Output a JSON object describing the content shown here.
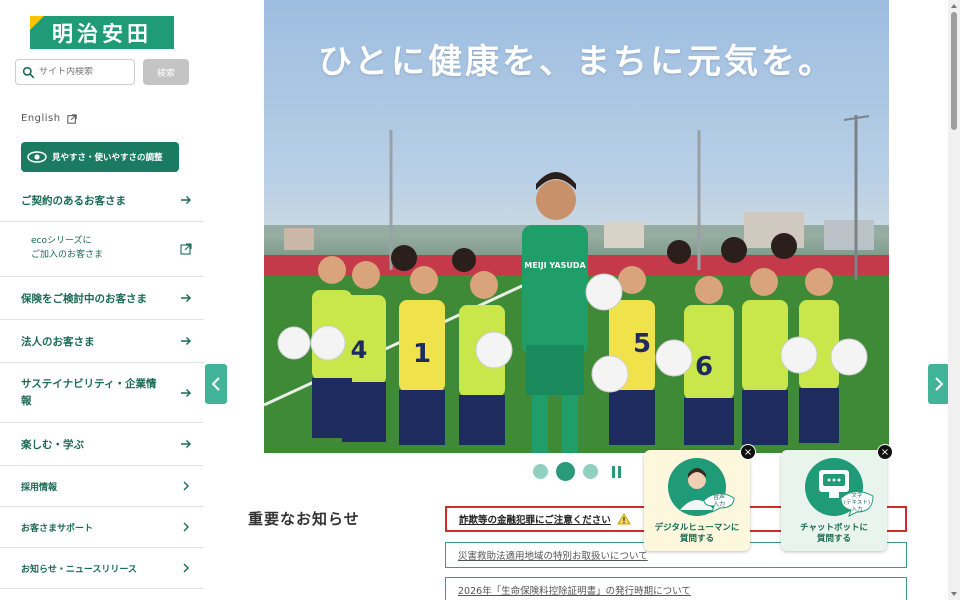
{
  "brand": {
    "logo_text": "明治安田",
    "accent": "#1f9b78",
    "logo_mark_color": "#f6c500"
  },
  "search": {
    "placeholder": "サイト内検索",
    "button_label": "検索"
  },
  "language_link": "English",
  "accessibility_button": "見やすさ・使いやすさの調整",
  "nav": {
    "items": [
      {
        "label": "ご契約のあるお客さま",
        "arrow": "arrow-right-icon"
      },
      {
        "label_line1": "ecoシリーズに",
        "label_line2": "ご加入のお客さま",
        "arrow": "external-link-icon"
      },
      {
        "label": "保険をご検討中のお客さま",
        "arrow": "arrow-right-icon"
      },
      {
        "label": "法人のお客さま",
        "arrow": "arrow-right-icon"
      },
      {
        "label_line1": "サステイナビリティ・企業情",
        "label_line2": "報",
        "arrow": "arrow-right-icon"
      },
      {
        "label": "楽しむ・学ぶ",
        "arrow": "arrow-right-icon"
      },
      {
        "label": "採用情報",
        "arrow": "chevron-right-icon"
      },
      {
        "label": "お客さまサポート",
        "arrow": "chevron-right-icon"
      },
      {
        "label": "お知らせ・ニュースリリース",
        "arrow": "chevron-right-icon"
      }
    ]
  },
  "hero": {
    "headline": "ひとに健康を、まちに元気を。",
    "jersey_text": "MEIJI YASUDA",
    "player_numbers": [
      "4",
      "1",
      "5",
      "6"
    ]
  },
  "carousel": {
    "slides": 3,
    "active": 2
  },
  "notices": {
    "title": "重要なお知らせ",
    "items": [
      {
        "text": "詐欺等の金融犯罪にご注意ください",
        "type": "alert"
      },
      {
        "text": "災害救助法適用地域の特別お取扱いについて",
        "type": "normal"
      },
      {
        "text": "2026年「生命保険料控除証明書」の発行時期について",
        "type": "normal"
      }
    ]
  },
  "assistants": {
    "human": {
      "line1": "デジタルヒューマンに",
      "line2": "質問する",
      "badge_line1": "音声",
      "badge_line2": "入力"
    },
    "chat": {
      "line1": "チャットボットに",
      "line2": "質問する",
      "badge_line1": "文字",
      "badge_line2": "(テキスト)",
      "badge_line3": "入力"
    }
  }
}
